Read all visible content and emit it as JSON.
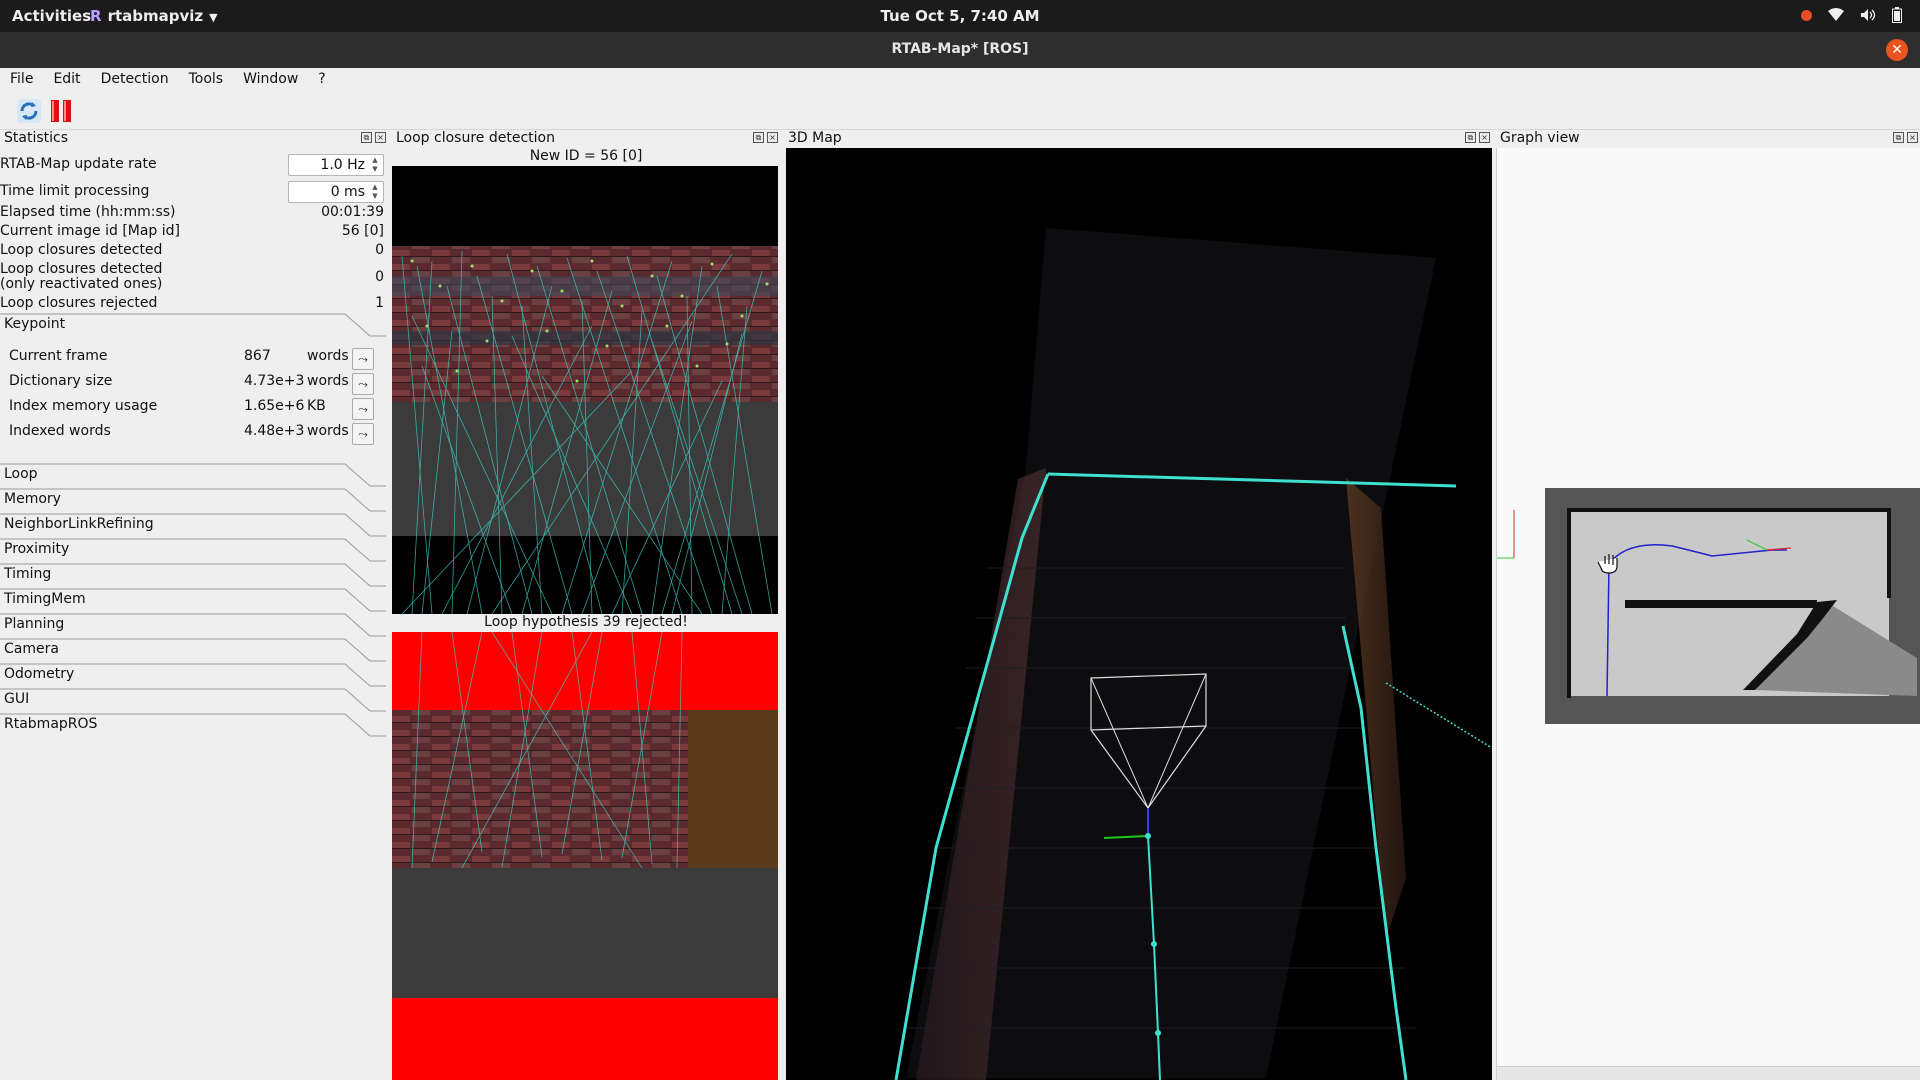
{
  "topbar": {
    "activities": "Activities",
    "app_name": "rtabmapviz",
    "clock": "Tue Oct  5, 7:40 AM"
  },
  "window": {
    "title": "RTAB-Map* [ROS]"
  },
  "menu": [
    "File",
    "Edit",
    "Detection",
    "Tools",
    "Window",
    "?"
  ],
  "colors": {
    "accent": "#e95420",
    "keypoint_lines": "#3fd3c8",
    "reject_red": "#ff0000",
    "graph_path": "#2222cc"
  },
  "statistics": {
    "title": "Statistics",
    "update_rate_label": "RTAB-Map update rate",
    "update_rate_value": "1.0 Hz",
    "time_limit_label": "Time limit processing",
    "time_limit_value": "0 ms",
    "elapsed_label": "Elapsed time (hh:mm:ss)",
    "elapsed_value": "00:01:39",
    "image_id_label": "Current image id [Map id]",
    "image_id_value": "56 [0]",
    "loop_detected_label": "Loop closures detected",
    "loop_detected_value": "0",
    "loop_reactivated_label_1": "Loop closures detected",
    "loop_reactivated_label_2": "(only reactivated ones)",
    "loop_reactivated_value": "0",
    "loop_rejected_label": "Loop closures rejected",
    "loop_rejected_value": "1",
    "keypoint_section": "Keypoint",
    "keypoint_rows": [
      {
        "label": "Current frame",
        "value": "867",
        "unit": "words"
      },
      {
        "label": "Dictionary size",
        "value": "4.73e+3",
        "unit": "words"
      },
      {
        "label": "Index memory usage",
        "value": "1.65e+6",
        "unit": "KB"
      },
      {
        "label": "Indexed words",
        "value": "4.48e+3",
        "unit": "words"
      }
    ],
    "sections": [
      "Loop",
      "Memory",
      "NeighborLinkRefining",
      "Proximity",
      "Timing",
      "TimingMem",
      "Planning",
      "Camera",
      "Odometry",
      "GUI",
      "RtabmapROS"
    ]
  },
  "loop_closure": {
    "title": "Loop closure detection",
    "new_id": "New ID = 56 [0]",
    "hypothesis": "Loop hypothesis 39 rejected!"
  },
  "map3d": {
    "title": "3D Map"
  },
  "graph_view": {
    "title": "Graph view"
  }
}
